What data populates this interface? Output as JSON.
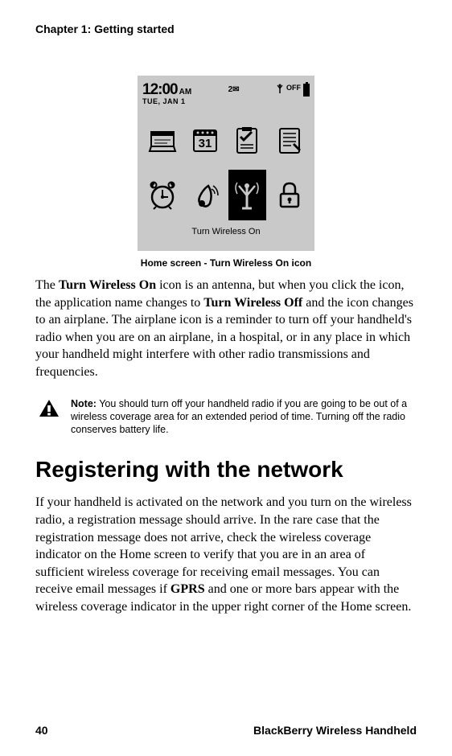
{
  "chapter_header": "Chapter 1: Getting started",
  "screen": {
    "time": "12:00",
    "ampm": "AM",
    "date": "TUE, JAN 1",
    "msg_count": "2",
    "signal_label": "OFF",
    "bottom_label": "Turn Wireless On"
  },
  "caption": "Home screen - Turn Wireless On icon",
  "para1_a": "The ",
  "para1_bold1": "Turn Wireless On",
  "para1_b": " icon is an antenna, but when you click the icon, the application name changes to ",
  "para1_bold2": "Turn Wireless Off",
  "para1_c": " and the icon changes to an airplane. The airplane icon is a reminder to turn off your handheld's radio when you are on an airplane, in a hospital, or in any place in which your handheld might interfere with other radio transmissions and frequencies.",
  "note_label": "Note:",
  "note_text": " You should turn off your handheld radio if you are going to be out of a wireless coverage area for an extended period of time. Turning off the radio conserves battery life.",
  "section_heading": "Registering with the network",
  "para2_a": "If your handheld is activated on the network and you turn on the wireless radio, a registration message should arrive. In the rare case that the registration message does not arrive, check the wireless coverage indicator on the Home screen to verify that you are in an area of sufficient wireless coverage for receiving email messages. You can receive email messages if ",
  "para2_bold1": "GPRS",
  "para2_b": " and one or more bars appear with the wireless coverage indicator in the upper right corner of the Home screen.",
  "footer": {
    "page": "40",
    "product": "BlackBerry Wireless Handheld"
  }
}
